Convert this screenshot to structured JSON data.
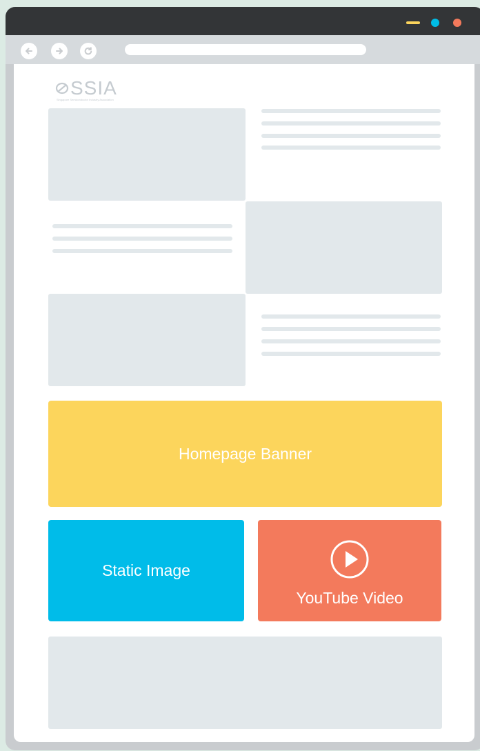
{
  "window": {
    "colors": {
      "minimize": "#fcd45c",
      "maximize": "#00bde6",
      "close": "#f37a5c"
    },
    "icons": [
      "back-arrow-icon",
      "forward-arrow-icon",
      "reload-icon"
    ]
  },
  "logo": {
    "text": "SSIA",
    "subtitle": "Singapore Semiconductor Industry Association"
  },
  "tiles": {
    "banner": {
      "label": "Homepage Banner",
      "color": "#fcd55c"
    },
    "static_image": {
      "label": "Static Image",
      "color": "#00bce9"
    },
    "youtube": {
      "label": "YouTube Video",
      "color": "#f37a5c",
      "icon": "play-circle-icon"
    }
  }
}
